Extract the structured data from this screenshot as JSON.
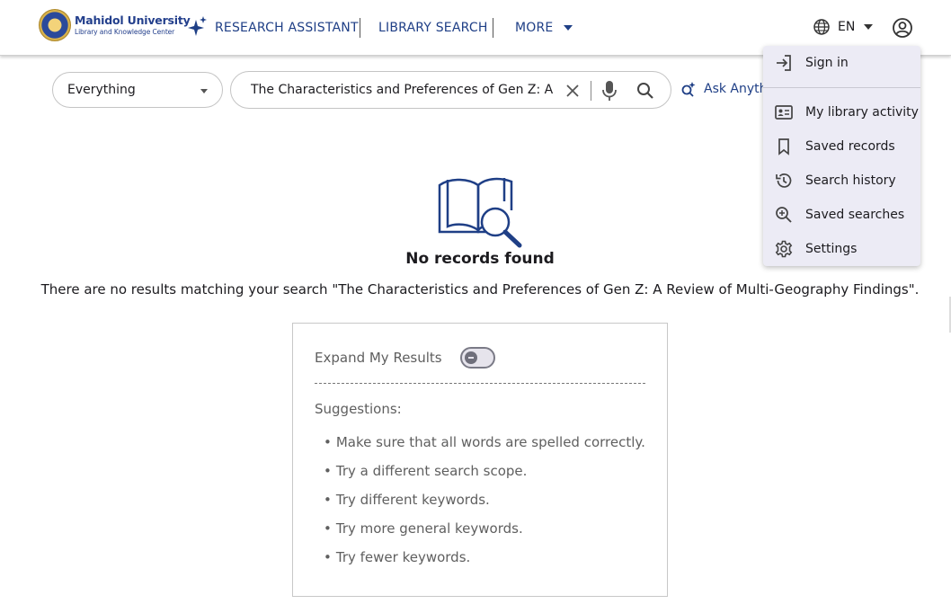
{
  "header": {
    "logo_name": "Mahidol University",
    "logo_sub": "Library and Knowledge Center",
    "nav": {
      "research_assistant": "RESEARCH ASSISTANT",
      "library_search": "LIBRARY SEARCH",
      "more": "MORE"
    },
    "language": "EN"
  },
  "search": {
    "scope": "Everything",
    "query": "The Characteristics and Preferences of Gen Z: A Review of Multi-Geography Findings",
    "ask_label": "Ask Anything"
  },
  "results": {
    "title": "No records found",
    "message": "There are no results matching your search \"The Characteristics and Preferences of Gen Z: A Review of Multi-Geography Findings\"."
  },
  "suggestions_box": {
    "expand_label": "Expand My Results",
    "expand_on": false,
    "title": "Suggestions:",
    "items": [
      "Make sure that all words are spelled correctly.",
      "Try a different search scope.",
      "Try different keywords.",
      "Try more general keywords.",
      "Try fewer keywords."
    ]
  },
  "user_menu": {
    "items": [
      {
        "label": "Sign in",
        "icon": "sign-in-icon"
      },
      {
        "label": "My library activity",
        "icon": "id-card-icon"
      },
      {
        "label": "Saved records",
        "icon": "bookmark-icon"
      },
      {
        "label": "Search history",
        "icon": "history-icon"
      },
      {
        "label": "Saved searches",
        "icon": "zoom-in-icon"
      },
      {
        "label": "Settings",
        "icon": "gear-icon"
      }
    ]
  },
  "colors": {
    "brand": "#1f3f86",
    "menu_bg": "#ecebf5",
    "text": "#1c1b1f",
    "muted": "#5f5f5f"
  }
}
